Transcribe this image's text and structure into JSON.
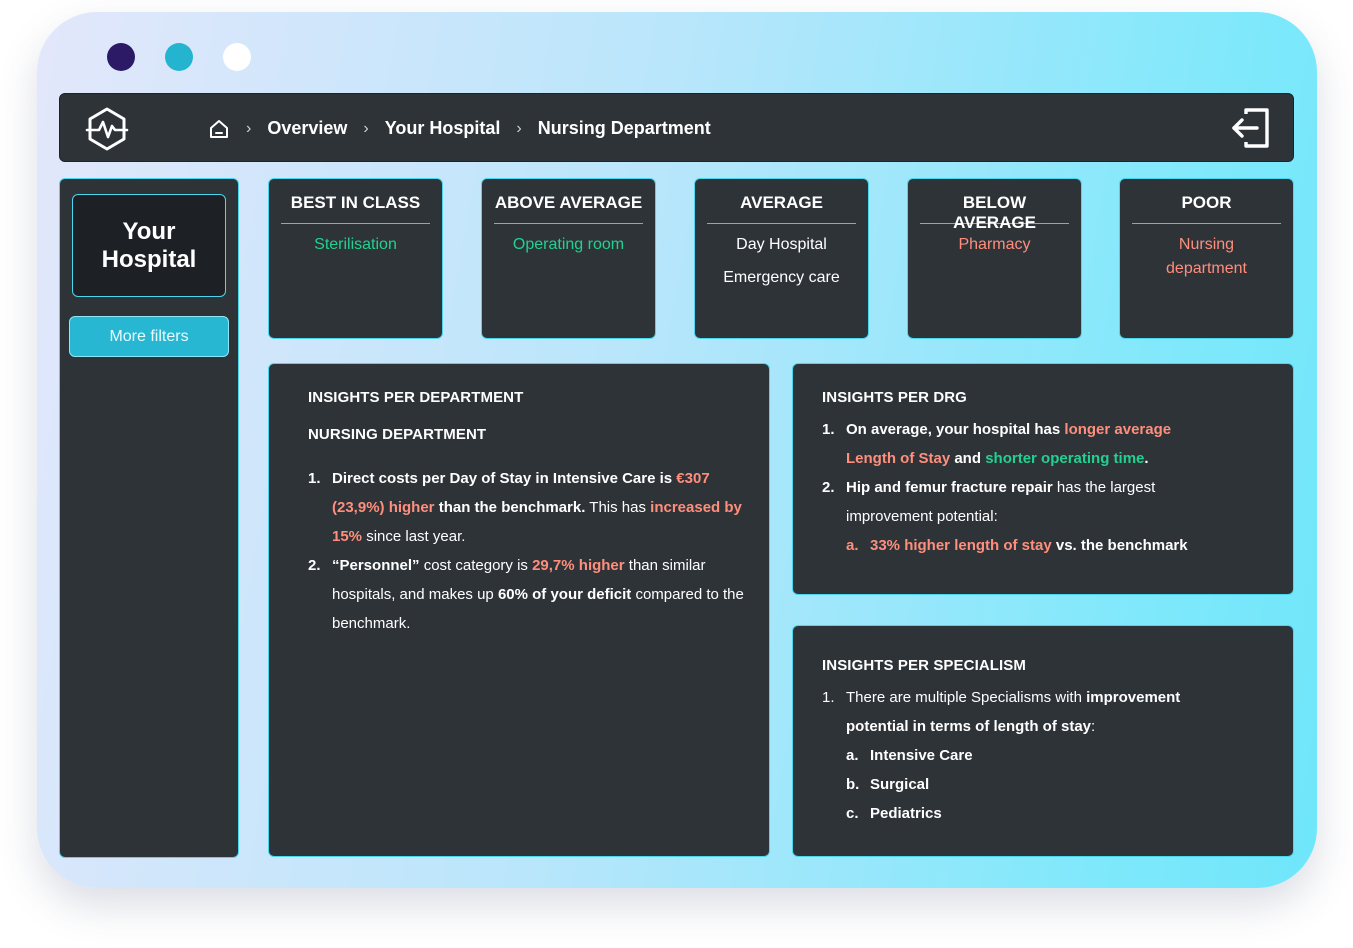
{
  "window": {
    "controls": [
      "close-dot",
      "minimize-dot",
      "maximize-dot"
    ]
  },
  "header": {
    "logo": "heart-monitor-hexagon-logo",
    "breadcrumbs": [
      "Overview",
      "Your Hospital",
      "Nursing Department"
    ],
    "home_icon": "home-icon",
    "exit_icon": "logout-icon"
  },
  "sidebar": {
    "selected_label": "Your Hospital",
    "filters_button": "More filters"
  },
  "categories": [
    {
      "title": "BEST IN CLASS",
      "items": [
        {
          "label": "Sterilisation",
          "tone": "green"
        }
      ]
    },
    {
      "title": "ABOVE AVERAGE",
      "items": [
        {
          "label": "Operating room",
          "tone": "green"
        }
      ]
    },
    {
      "title": "AVERAGE",
      "items": [
        {
          "label": "Day Hospital",
          "tone": "white"
        },
        {
          "label": "Emergency care",
          "tone": "white"
        }
      ]
    },
    {
      "title": "BELOW AVERAGE",
      "items": [
        {
          "label": "Pharmacy",
          "tone": "salmon"
        }
      ]
    },
    {
      "title": "POOR",
      "items": [
        {
          "label": "Nursing department",
          "tone": "salmon"
        }
      ]
    }
  ],
  "dept_panel": {
    "title": "INSIGHTS PER DEPARTMENT",
    "subtitle": "NURSING DEPARTMENT",
    "i1": {
      "n": "1.",
      "a": "Direct costs per Day of Stay in Intensive Care is ",
      "b": "€307 (23,9%) higher",
      "c": " than the benchmark.",
      "d": " This has ",
      "e": "increased by 15%",
      "f": " since last year."
    },
    "i2": {
      "n": "2.",
      "a": "“Personnel”",
      "b": " cost category  is ",
      "c": "29,7% higher",
      "d": " than similar hospitals, and makes up ",
      "e": "60% of your deficit",
      "f": " compared to the benchmark."
    }
  },
  "drg_panel": {
    "title": "INSIGHTS PER DRG",
    "i1": {
      "n": "1.",
      "a": "On average, your hospital has ",
      "b": "longer average Length of Stay",
      "c": " and ",
      "d": "shorter operating time",
      "e": "."
    },
    "i2": {
      "n": "2.",
      "a": "Hip and femur fracture repair",
      "b": " has the largest improvement potential:"
    },
    "sub": {
      "n": "a.",
      "a": "33% higher length of stay",
      "b": " vs. the benchmark"
    }
  },
  "spec_panel": {
    "title": "INSIGHTS PER SPECIALISM",
    "i1": {
      "n": "1.",
      "a": "There are multiple Specialisms with ",
      "b": "improvement potential in terms of length of stay",
      "c": ":"
    },
    "subs": [
      {
        "n": "a.",
        "label": "Intensive Care"
      },
      {
        "n": "b.",
        "label": "Surgical"
      },
      {
        "n": "c.",
        "label": "Pediatrics"
      }
    ]
  },
  "colors": {
    "green": "#22d18f",
    "salmon": "#ff8e7c",
    "accent": "#27b7d2",
    "panel": "#2e3338"
  }
}
